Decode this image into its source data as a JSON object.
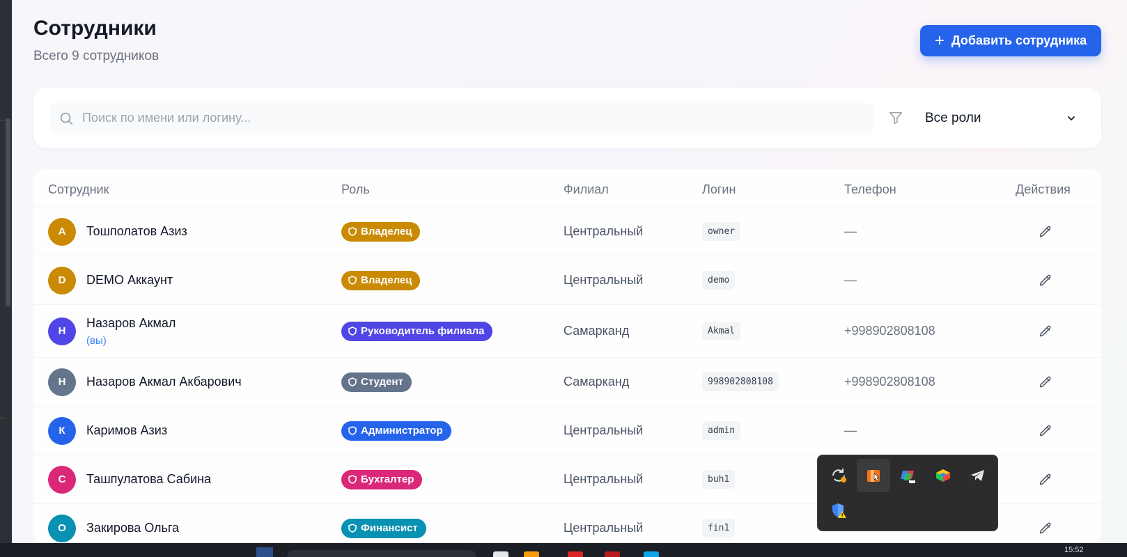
{
  "header": {
    "title": "Сотрудники",
    "subtitle": "Всего 9 сотрудников",
    "add_button_label": "Добавить сотрудника"
  },
  "filters": {
    "search_placeholder": "Поиск по имени или логину...",
    "role_select_value": "Все роли"
  },
  "table": {
    "columns": {
      "employee": "Сотрудник",
      "role": "Роль",
      "branch": "Филиал",
      "login": "Логин",
      "phone": "Телефон",
      "actions": "Действия"
    },
    "rows": [
      {
        "initial": "А",
        "name": "Тошполатов Азиз",
        "you": "",
        "role": "Владелец",
        "branch": "Центральный",
        "login": "owner",
        "phone": "—",
        "avatar_color": "#ca8a04",
        "role_color": "#ca8a04"
      },
      {
        "initial": "D",
        "name": "DEMO Аккаунт",
        "you": "",
        "role": "Владелец",
        "branch": "Центральный",
        "login": "demo",
        "phone": "—",
        "avatar_color": "#ca8a04",
        "role_color": "#ca8a04"
      },
      {
        "initial": "Н",
        "name": "Назаров Акмал",
        "you": "(вы)",
        "role": "Руководитель филиала",
        "branch": "Самарканд",
        "login": "Akmal",
        "phone": "+998902808108",
        "avatar_color": "#4f46e5",
        "role_color": "#4f46e5"
      },
      {
        "initial": "Н",
        "name": "Назаров Акмал Акбарович",
        "you": "",
        "role": "Студент",
        "branch": "Самарканд",
        "login": "998902808108",
        "phone": "+998902808108",
        "avatar_color": "#64748b",
        "role_color": "#64748b"
      },
      {
        "initial": "К",
        "name": "Каримов Азиз",
        "you": "",
        "role": "Администратор",
        "branch": "Центральный",
        "login": "admin",
        "phone": "—",
        "avatar_color": "#2563eb",
        "role_color": "#2563eb"
      },
      {
        "initial": "С",
        "name": "Ташпулатова Сабина",
        "you": "",
        "role": "Бухгалтер",
        "branch": "Центральный",
        "login": "buh1",
        "phone": "",
        "avatar_color": "#db2777",
        "role_color": "#db2777"
      },
      {
        "initial": "О",
        "name": "Закирова Ольга",
        "you": "",
        "role": "Финансист",
        "branch": "Центральный",
        "login": "fin1",
        "phone": "—",
        "avatar_color": "#0891b2",
        "role_color": "#0891b2"
      }
    ]
  },
  "tray": {
    "icons": [
      "sync-update-icon",
      "office-app-icon",
      "pos-app-icon",
      "bluestacks-icon",
      "telegram-icon",
      "security-warning-icon"
    ]
  },
  "taskbar": {
    "clock": "15:52"
  },
  "colors": {
    "accent": "#2563eb"
  }
}
